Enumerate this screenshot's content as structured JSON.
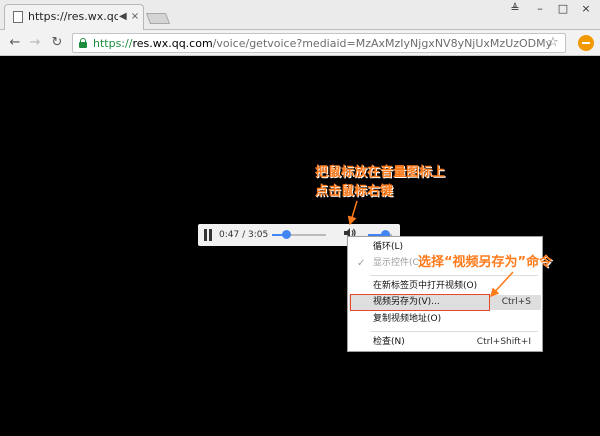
{
  "browser": {
    "tab_title": "https://res.wx.qq.com",
    "audio_icon": "speaker-icon",
    "close_glyph": "×",
    "window_buttons": {
      "user": "≜",
      "min": "–",
      "max": "□",
      "close": "×"
    },
    "nav": {
      "back": "←",
      "forward": "→",
      "reload": "↻"
    },
    "url": {
      "scheme": "https://",
      "host": "res.wx.qq.com",
      "path": "/voice/getvoice?mediaid=MzAxMzIyNjgxNV8yNjUxMzUzODMy"
    },
    "bookmark_glyph": "☆",
    "accent_secure": "#1e8e3e",
    "menu_badge_color": "#f29900"
  },
  "player": {
    "time": "0:47 / 3:05",
    "progress": 0.25,
    "volume": 0.7,
    "accent": "#4285f4",
    "volume_glyph": "🔊"
  },
  "context_menu": {
    "items": [
      {
        "label": "循环(L)",
        "shortcut": ""
      },
      {
        "label": "显示控件(C)",
        "shortcut": ""
      },
      {
        "label": "在新标签页中打开视频(O)",
        "shortcut": ""
      },
      {
        "label": "视频另存为(V)...",
        "shortcut": "Ctrl+S"
      },
      {
        "label": "复制视频地址(O)",
        "shortcut": ""
      },
      {
        "label": "检查(N)",
        "shortcut": "Ctrl+Shift+I"
      }
    ],
    "check_glyph": "✓"
  },
  "annotations": {
    "line1": "把鼠标放在音量图标上",
    "line2": "点击鼠标右键",
    "save_hint": "选择“视频另存为”命令",
    "color": "#ff7a1a",
    "box_color": "#e8482a"
  }
}
